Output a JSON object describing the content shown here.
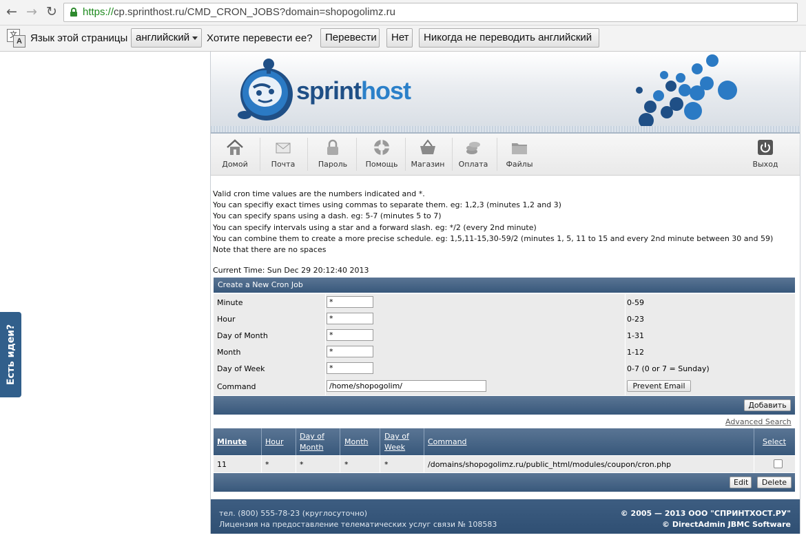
{
  "browser": {
    "url_https": "https://",
    "url_rest": "cp.sprinthost.ru/CMD_CRON_JOBS?domain=shopogolimz.ru",
    "translate_bar": {
      "language_label": "Язык этой страницы",
      "language_value": "английский",
      "question": "Хотите перевести ее?",
      "translate_button": "Перевести",
      "no_button": "Нет",
      "never_button": "Никогда не переводить английский"
    }
  },
  "feedback_tab": "Есть идеи?",
  "logo": {
    "part1": "sprint",
    "part2": "host"
  },
  "toolbar": {
    "home": "Домой",
    "mail": "Почта",
    "password": "Пароль",
    "help": "Помощь",
    "shop": "Магазин",
    "payment": "Оплата",
    "files": "Файлы",
    "logout": "Выход"
  },
  "info_lines": [
    "Valid cron time values are the numbers indicated and *.",
    "You can specifiy exact times using commas to separate them. eg: 1,2,3 (minutes 1,2 and 3)",
    "You can specify spans using a dash. eg: 5-7 (minutes 5 to 7)",
    "You can specify intervals using a star and a forward slash. eg: */2 (every 2nd minute)",
    "You can combine them to create a more precise schedule. eg: 1,5,11-15,30-59/2 (minutes 1, 5, 11 to 15 and every 2nd minute between 30 and 59)",
    "Note that there are no spaces"
  ],
  "current_time": "Current Time: Sun Dec 29 20:12:40 2013",
  "create": {
    "title": "Create a New Cron Job",
    "rows": [
      {
        "label": "Minute",
        "value": "*",
        "range": "0-59"
      },
      {
        "label": "Hour",
        "value": "*",
        "range": "0-23"
      },
      {
        "label": "Day of Month",
        "value": "*",
        "range": "1-31"
      },
      {
        "label": "Month",
        "value": "*",
        "range": "1-12"
      },
      {
        "label": "Day of Week",
        "value": "*",
        "range": "0-7 (0 or 7 = Sunday)"
      }
    ],
    "command_label": "Command",
    "command_value": "/home/shopogolim/",
    "prevent_email": "Prevent Email",
    "add_button": "Добавить"
  },
  "advanced_search": "Advanced Search",
  "table": {
    "headers": {
      "minute": "Minute",
      "hour": "Hour",
      "dom_1": "Day of",
      "dom_2": "Month",
      "month": "Month",
      "dow_1": "Day of",
      "dow_2": "Week",
      "command": "Command",
      "select": "Select"
    },
    "rows": [
      {
        "minute": "11",
        "hour": "*",
        "dom": "*",
        "month": "*",
        "dow": "*",
        "command": "/domains/shopogolimz.ru/public_html/modules/coupon/cron.php"
      }
    ],
    "edit_button": "Edit",
    "delete_button": "Delete"
  },
  "footer": {
    "phone": "тел. (800) 555-78-23 (круглосуточно)",
    "license": "Лицензия на предоставление телематических услуг связи № 108583",
    "copyright": "© 2005 — 2013  ООО \"СПРИНТХОСТ.РУ\"",
    "software": "© DirectAdmin JBMC Software"
  }
}
